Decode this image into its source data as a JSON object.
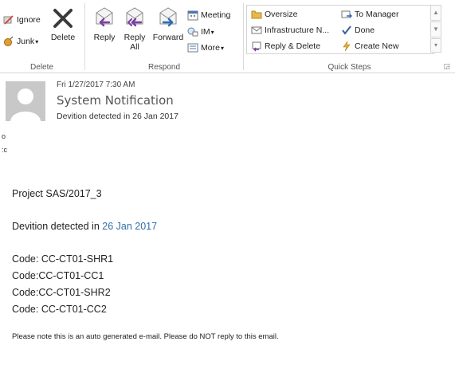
{
  "ribbon": {
    "delete_group": {
      "ignore_label": "Ignore",
      "junk_label": "Junk",
      "delete_label": "Delete",
      "group_label": "Delete"
    },
    "respond_group": {
      "reply_label": "Reply",
      "reply_all_line1": "Reply",
      "reply_all_line2": "All",
      "forward_label": "Forward",
      "meeting_label": "Meeting",
      "im_label": "IM",
      "more_label": "More",
      "group_label": "Respond"
    },
    "quick_steps": {
      "items": [
        {
          "label": "Oversize",
          "icon": "folder-icon"
        },
        {
          "label": "To Manager",
          "icon": "forward-arrow-icon"
        },
        {
          "label": "Infrastructure N...",
          "icon": "envelope-icon"
        },
        {
          "label": "Done",
          "icon": "checkmark-icon"
        },
        {
          "label": "Reply & Delete",
          "icon": "reply-icon"
        },
        {
          "label": "Create New",
          "icon": "lightning-icon"
        }
      ],
      "group_label": "Quick Steps"
    }
  },
  "message": {
    "date": "Fri 1/27/2017 7:30 AM",
    "sender": "System Notification",
    "subject": "Devition detected in 26 Jan 2017",
    "edge_chars": [
      "o",
      ":c"
    ],
    "body": {
      "project": "Project SAS/2017_3",
      "devition_prefix": "Devition detected in ",
      "devition_date": "26 Jan 2017",
      "codes": [
        "Code: CC-CT01-SHR1",
        "Code:CC-CT01-CC1",
        "Code:CC-CT01-SHR2",
        "Code: CC-CT01-CC2"
      ],
      "footer": "Please note this is an auto generated e-mail. Please do NOT reply to this email."
    }
  },
  "colors": {
    "link_blue": "#2f6fa7",
    "arrow_purple": "#7a3fa0",
    "arrow_blue": "#2b6cb8",
    "delete_x": "#3a3a3a"
  }
}
